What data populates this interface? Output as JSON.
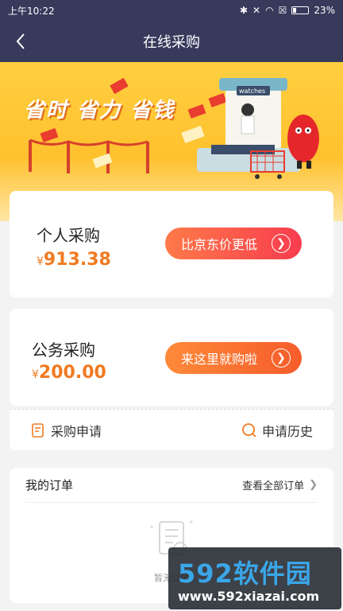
{
  "status_bar": {
    "time": "上午10:22",
    "battery": "23%"
  },
  "nav": {
    "title": "在线采购"
  },
  "banner": {
    "slogan": "省时 省力 省钱",
    "sign": "watches"
  },
  "personal": {
    "name": "个人采购",
    "currency": "¥",
    "amount": "913.38",
    "button": "比京东价更低"
  },
  "official": {
    "name": "公务采购",
    "currency": "¥",
    "amount": "200.00",
    "button": "来这里就购啦"
  },
  "actions": {
    "apply": "采购申请",
    "history": "申请历史"
  },
  "orders": {
    "title": "我的订单",
    "view_all": "查看全部订单",
    "empty_text": "暂无订单"
  },
  "watermark": {
    "brand": "592软件园",
    "url": "www.592xiazai.com"
  },
  "colors": {
    "nav_bg": "#383a5c",
    "accent_orange": "#f07a22",
    "button_red": "#f73c4e"
  }
}
